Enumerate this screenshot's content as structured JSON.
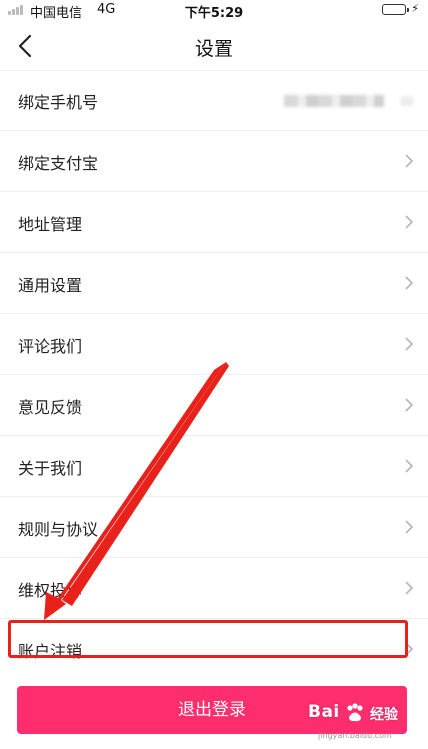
{
  "status_bar": {
    "carrier": "中国电信",
    "network": "4G",
    "time": "下午5:29",
    "battery_level": 1.0,
    "battery_color": "#4cd964"
  },
  "nav": {
    "back_icon": "chevron-left-icon",
    "title": "设置"
  },
  "settings": {
    "items": [
      {
        "label": "绑定手机号",
        "value_blurred": true
      },
      {
        "label": "绑定支付宝"
      },
      {
        "label": "地址管理"
      },
      {
        "label": "通用设置"
      },
      {
        "label": "评论我们"
      },
      {
        "label": "意见反馈"
      },
      {
        "label": "关于我们"
      },
      {
        "label": "规则与协议"
      },
      {
        "label": "维权投诉"
      },
      {
        "label": "账户注销",
        "highlighted": true
      }
    ],
    "chevron_icon": "chevron-right-icon"
  },
  "logout": {
    "label": "退出登录",
    "color": "#fd2d6e"
  },
  "annotation": {
    "arrow_color": "#e8221b",
    "highlight_color": "#e8221b"
  },
  "watermark": {
    "brand": "Bai",
    "brand_cn": "经验",
    "url": "jingyan.baidu.com"
  }
}
